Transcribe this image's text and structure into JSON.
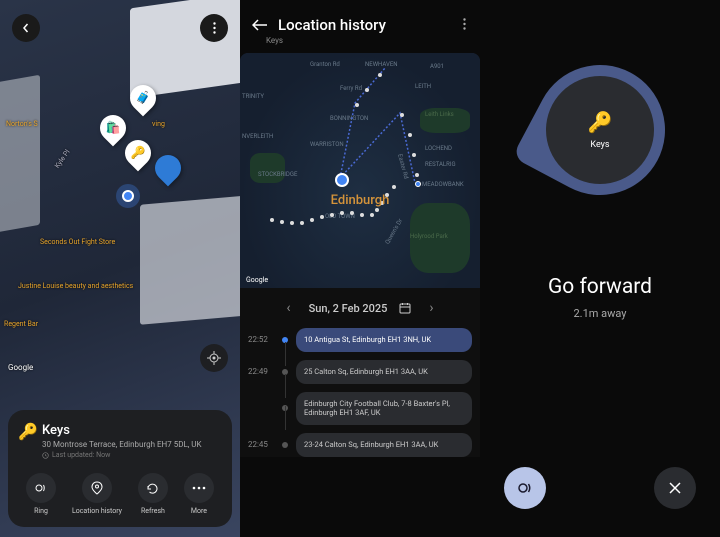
{
  "panel1": {
    "item_name": "Keys",
    "address": "30 Montrose Terrace, Edinburgh EH7 5DL, UK",
    "last_updated": "Last updated: Now",
    "actions": {
      "ring": "Ring",
      "history": "Location history",
      "refresh": "Refresh",
      "more": "More"
    },
    "pois": {
      "norton": "Norton's S",
      "ving": "ving",
      "kyle": "Kyle Pl",
      "seconds": "Seconds Out Fight Store",
      "justine": "Justine Louise beauty and aesthetics",
      "regent": "Regent Bar"
    },
    "google": "Google"
  },
  "panel2": {
    "title": "Location history",
    "subtitle": "Keys",
    "city": "Edinburgh",
    "date": "Sun, 2 Feb 2025",
    "google": "Google",
    "roads": {
      "granton": "Granton Rd",
      "newhaven": "NEWHAVEN",
      "a901": "A901",
      "ferry": "Ferry Rd",
      "leith": "LEITH",
      "leithlinks": "Leith Links",
      "trinity": "TRINITY",
      "bonnington": "BONNINGTON",
      "inverleith": "NVERLEITH",
      "warriston": "WARRISTON",
      "stockbridge": "STOCKBRIDGE",
      "easter": "Easter Rd",
      "lochend": "LOCHEND",
      "restalrig": "RESTALRIG",
      "meadowbank": "MEADOWBANK",
      "holyrood": "Holyrood Park",
      "oldtown": "OLD TOWN",
      "queens": "Queen's Dr"
    },
    "entries": [
      {
        "time": "22:52",
        "addr": "10 Antigua St, Edinburgh EH1 3NH, UK",
        "active": true
      },
      {
        "time": "22:49",
        "addr": "25 Calton Sq, Edinburgh EH1 3AA, UK",
        "active": false
      },
      {
        "time": "",
        "addr": "Edinburgh City Football Club, 7-8 Baxter's Pl, Edinburgh EH1 3AF, UK",
        "active": false
      },
      {
        "time": "22:45",
        "addr": "23-24 Calton Sq, Edinburgh EH1 3AA, UK",
        "active": false
      }
    ]
  },
  "panel3": {
    "item_name": "Keys",
    "direction": "Go forward",
    "distance": "2.1m away"
  }
}
